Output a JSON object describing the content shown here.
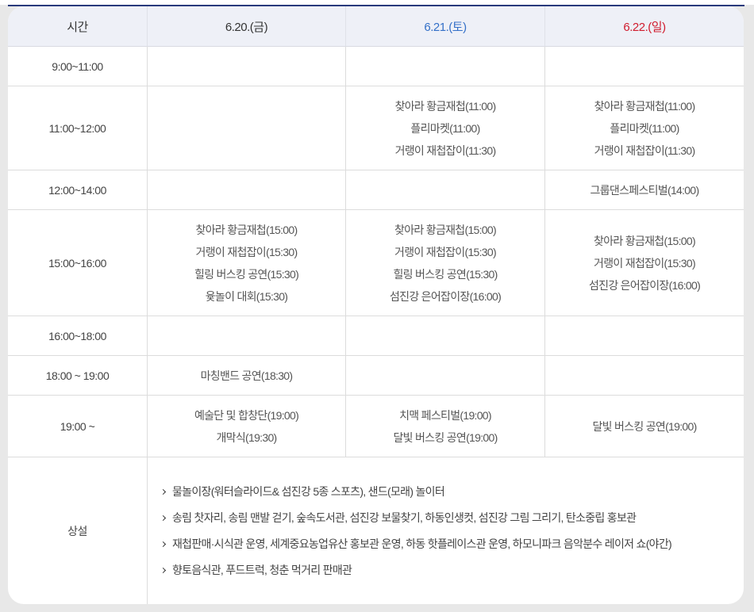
{
  "colors": {
    "accent": "#293a7c"
  },
  "header": {
    "time_label": "시간",
    "days": [
      {
        "label": "6.20.(금)",
        "color": "#333333"
      },
      {
        "label": "6.21.(토)",
        "color": "#3470c8"
      },
      {
        "label": "6.22.(일)",
        "color": "#d01c2e"
      }
    ]
  },
  "rows": [
    {
      "time": "9:00~11:00",
      "cells": [
        [],
        [],
        []
      ]
    },
    {
      "time": "11:00~12:00",
      "cells": [
        [],
        [
          "찾아라 황금재첩(11:00)",
          "플리마켓(11:00)",
          "거랭이 재첩잡이(11:30)"
        ],
        [
          "찾아라 황금재첩(11:00)",
          "플리마켓(11:00)",
          "거랭이 재첩잡이(11:30)"
        ]
      ]
    },
    {
      "time": "12:00~14:00",
      "cells": [
        [],
        [],
        [
          "그룹댄스페스티벌(14:00)"
        ]
      ]
    },
    {
      "time": "15:00~16:00",
      "cells": [
        [
          "찾아라 황금재첩(15:00)",
          "거랭이 재첩잡이(15:30)",
          "힐링 버스킹 공연(15:30)",
          "윷놀이 대회(15:30)"
        ],
        [
          "찾아라 황금재첩(15:00)",
          "거랭이 재첩잡이(15:30)",
          "힐링 버스킹 공연(15:30)",
          "섬진강 은어잡이장(16:00)"
        ],
        [
          "찾아라 황금재첩(15:00)",
          "거랭이 재첩잡이(15:30)",
          "섬진강 은어잡이장(16:00)"
        ]
      ]
    },
    {
      "time": "16:00~18:00",
      "cells": [
        [],
        [],
        []
      ]
    },
    {
      "time": "18:00 ~ 19:00",
      "cells": [
        [
          "마칭밴드 공연(18:30)"
        ],
        [],
        []
      ]
    },
    {
      "time": "19:00 ~",
      "cells": [
        [
          "예술단 및 합창단(19:00)",
          "개막식(19:30)"
        ],
        [
          "치맥 페스티벌(19:00)",
          "달빛 버스킹 공연(19:00)"
        ],
        [
          "달빛 버스킹 공연(19:00)"
        ]
      ]
    }
  ],
  "permanent": {
    "label": "상설",
    "bullet_icon": "chevron-right-icon",
    "items": [
      "물놀이장(워터슬라이드& 섬진강 5종 스포츠), 샌드(모래) 놀이터",
      "송림 찻자리, 송림 맨발 걷기, 숲속도서관, 섬진강 보물찾기, 하동인생컷, 섬진강 그림 그리기, 탄소중립 홍보관",
      "재첩판매·시식관 운영, 세계중요농업유산 홍보관 운영, 하동 핫플레이스관 운영, 하모니파크 음악분수 레이저 쇼(야간)",
      "향토음식관, 푸드트럭, 청춘 먹거리 판매관"
    ]
  }
}
